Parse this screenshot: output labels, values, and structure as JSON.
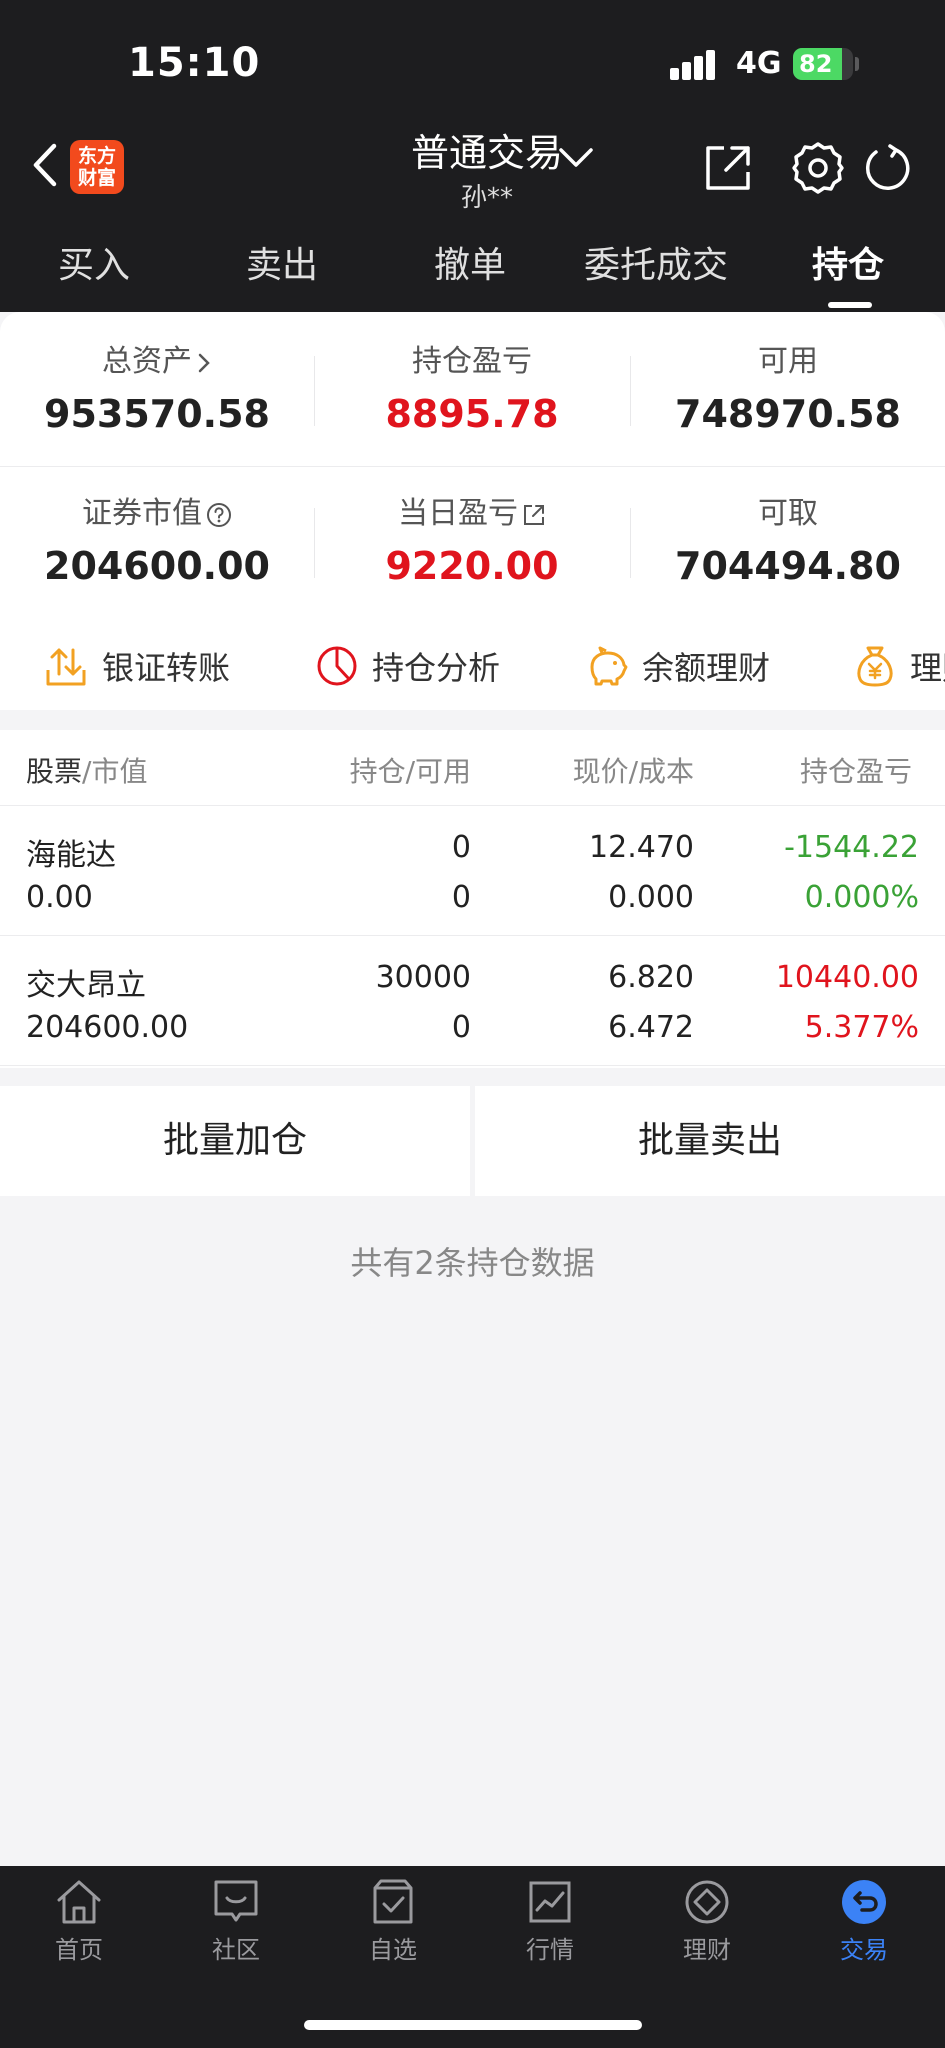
{
  "status_bar": {
    "time": "15:10",
    "network": "4G",
    "battery": "82",
    "battery_level": 82
  },
  "header": {
    "logo_line1": "东方",
    "logo_line2": "财富",
    "title": "普通交易",
    "account": "孙**"
  },
  "tabs": [
    {
      "label": "买入"
    },
    {
      "label": "卖出"
    },
    {
      "label": "撤单"
    },
    {
      "label": "委托成交"
    },
    {
      "label": "持仓",
      "active": true
    }
  ],
  "summary": {
    "total_assets_label": "总资产",
    "total_assets": "953570.58",
    "position_pnl_label": "持仓盈亏",
    "position_pnl": "8895.78",
    "available_label": "可用",
    "available": "748970.58",
    "market_value_label": "证券市值",
    "market_value": "204600.00",
    "daily_pnl_label": "当日盈亏",
    "daily_pnl": "9220.00",
    "withdrawable_label": "可取",
    "withdrawable": "704494.80"
  },
  "quick_actions": [
    {
      "label": "银证转账",
      "icon": "transfer-icon"
    },
    {
      "label": "持仓分析",
      "icon": "pie-chart-icon"
    },
    {
      "label": "余额理财",
      "icon": "piggy-bank-icon"
    },
    {
      "label": "理财",
      "icon": "money-bag-icon"
    }
  ],
  "table": {
    "headers": {
      "stock": "股票",
      "market_value": "/市值",
      "position": "持仓/可用",
      "price": "现价/成本",
      "pnl": "持仓盈亏"
    },
    "rows": [
      {
        "name": "海能达",
        "market_value": "0.00",
        "position": "0",
        "available": "0",
        "price": "12.470",
        "cost": "0.000",
        "pnl": "-1544.22",
        "pnl_pct": "0.000%"
      },
      {
        "name": "交大昂立",
        "market_value": "204600.00",
        "position": "30000",
        "available": "0",
        "price": "6.820",
        "cost": "6.472",
        "pnl": "10440.00",
        "pnl_pct": "5.377%"
      }
    ]
  },
  "batch": {
    "add": "批量加仓",
    "sell": "批量卖出"
  },
  "footer_note": "共有2条持仓数据",
  "bottom_nav": [
    {
      "label": "首页",
      "icon": "home-icon"
    },
    {
      "label": "社区",
      "icon": "community-icon"
    },
    {
      "label": "自选",
      "icon": "watchlist-icon"
    },
    {
      "label": "行情",
      "icon": "market-icon"
    },
    {
      "label": "理财",
      "icon": "wealth-icon"
    },
    {
      "label": "交易",
      "icon": "trade-icon",
      "active": true
    }
  ],
  "colors": {
    "red": "#e0141d",
    "green": "#3aa236",
    "accent": "#3b82f6",
    "orange": "#f2a122",
    "header_bg": "#1d1d1f"
  }
}
